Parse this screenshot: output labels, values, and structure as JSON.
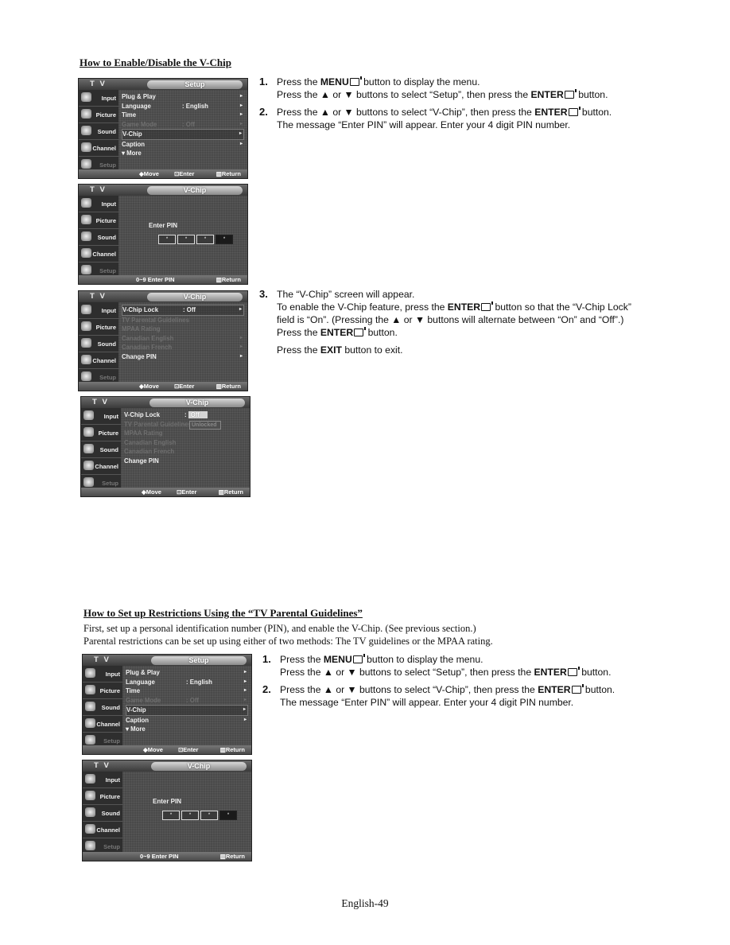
{
  "section1": {
    "title": "How to Enable/Disable the V-Chip",
    "steps_a": [
      {
        "num": "1.",
        "lines": [
          {
            "pre": "Press the ",
            "bold": "MENU",
            "post": " button to display the menu."
          },
          {
            "pre": "Press the ▲ or ▼ buttons to select “Setup”, then press the ",
            "bold": "ENTER",
            "post": " button."
          }
        ]
      },
      {
        "num": "2.",
        "lines": [
          {
            "pre": "Press the ▲ or ▼ buttons to select “V-Chip”, then press the ",
            "bold": "ENTER",
            "post": " button."
          },
          {
            "pre": "The message “Enter PIN” will appear. Enter your 4 digit PIN number.",
            "bold": "",
            "post": ""
          }
        ]
      }
    ],
    "step3": {
      "num": "3.",
      "line1": "The “V-Chip” screen will appear.",
      "line2_pre": "To enable the V-Chip feature, press the ",
      "line2_bold": "ENTER",
      "line2_post": " button so that the “V-Chip Lock”",
      "line3": "field is “On”. (Pressing the ▲ or ▼ buttons will alternate between “On” and “Off”.)",
      "line4_pre": "Press the ",
      "line4_bold": "ENTER",
      "line4_post": " button.",
      "line5_pre": "Press the ",
      "line5_bold": "EXIT",
      "line5_post": " button to exit."
    }
  },
  "section2": {
    "title": "How to Set up Restrictions Using the “TV Parental Guidelines”",
    "intro1": "First, set up a personal identification number (PIN), and enable the V-Chip. (See previous section.)",
    "intro2": "Parental restrictions can be set up using either of two methods: The TV guidelines or the MPAA rating.",
    "steps": [
      {
        "num": "1.",
        "lines": [
          {
            "pre": "Press the ",
            "bold": "MENU",
            "post": " button to display the menu."
          },
          {
            "pre": "Press the ▲ or ▼ buttons to select “Setup”, then press the ",
            "bold": "ENTER",
            "post": " button."
          }
        ]
      },
      {
        "num": "2.",
        "lines": [
          {
            "pre": "Press the ▲ or ▼ buttons to select “V-Chip”, then press the ",
            "bold": "ENTER",
            "post": " button."
          },
          {
            "pre": "The message “Enter PIN” will appear. Enter your 4 digit PIN number.",
            "bold": "",
            "post": ""
          }
        ]
      }
    ]
  },
  "osd_common": {
    "tv_label": "T V",
    "sidebar": [
      "Input",
      "Picture",
      "Sound",
      "Channel",
      "Setup"
    ],
    "hint_move": "◆Move",
    "hint_enter": "Enter",
    "hint_return": "Return",
    "hint_pin": "0~9 Enter PIN",
    "arrow": "▸"
  },
  "screens": {
    "setup": {
      "title": "Setup",
      "rows": [
        {
          "label": "Plug & Play",
          "value": "",
          "arrow": true,
          "dim": false
        },
        {
          "label": "Language",
          "value": ": English",
          "arrow": true,
          "dim": false
        },
        {
          "label": "Time",
          "value": "",
          "arrow": true,
          "dim": false
        },
        {
          "label": "Game Mode",
          "value": ": Off",
          "arrow": true,
          "dim": true
        },
        {
          "label": "V-Chip",
          "value": "",
          "arrow": true,
          "dim": false,
          "selected": true
        },
        {
          "label": "Caption",
          "value": "",
          "arrow": true,
          "dim": false
        },
        {
          "label": "▾ More",
          "value": "",
          "arrow": false,
          "dim": false
        }
      ]
    },
    "pin": {
      "title": "V-Chip",
      "label": "Enter PIN",
      "boxes": [
        "*",
        "*",
        "*",
        "*"
      ]
    },
    "vchip": {
      "title": "V-Chip",
      "rows": [
        {
          "label": "V-Chip Lock",
          "value": ": Off",
          "arrow": true,
          "dim": false,
          "selected": true
        },
        {
          "label": "TV Parental Guidelines",
          "value": "",
          "arrow": false,
          "dim": true
        },
        {
          "label": "MPAA Rating",
          "value": "",
          "arrow": false,
          "dim": true
        },
        {
          "label": "Canadian English",
          "value": "",
          "arrow": true,
          "dim": true
        },
        {
          "label": "Canadian French",
          "value": "",
          "arrow": true,
          "dim": true
        },
        {
          "label": "Change PIN",
          "value": "",
          "arrow": true,
          "dim": false
        }
      ]
    },
    "vchip_open": {
      "title": "V-Chip",
      "lock_label": "V-Chip Lock",
      "lock_value": "Off",
      "dropdown_option": "Unlocked",
      "rows": [
        {
          "label": "TV Parental Guidelines",
          "dim": true
        },
        {
          "label": "MPAA Rating",
          "dim": true
        },
        {
          "label": "Canadian English",
          "dim": true
        },
        {
          "label": "Canadian French",
          "dim": true
        },
        {
          "label": "Change PIN",
          "dim": false
        }
      ]
    }
  },
  "footer": {
    "page": "English-49"
  }
}
